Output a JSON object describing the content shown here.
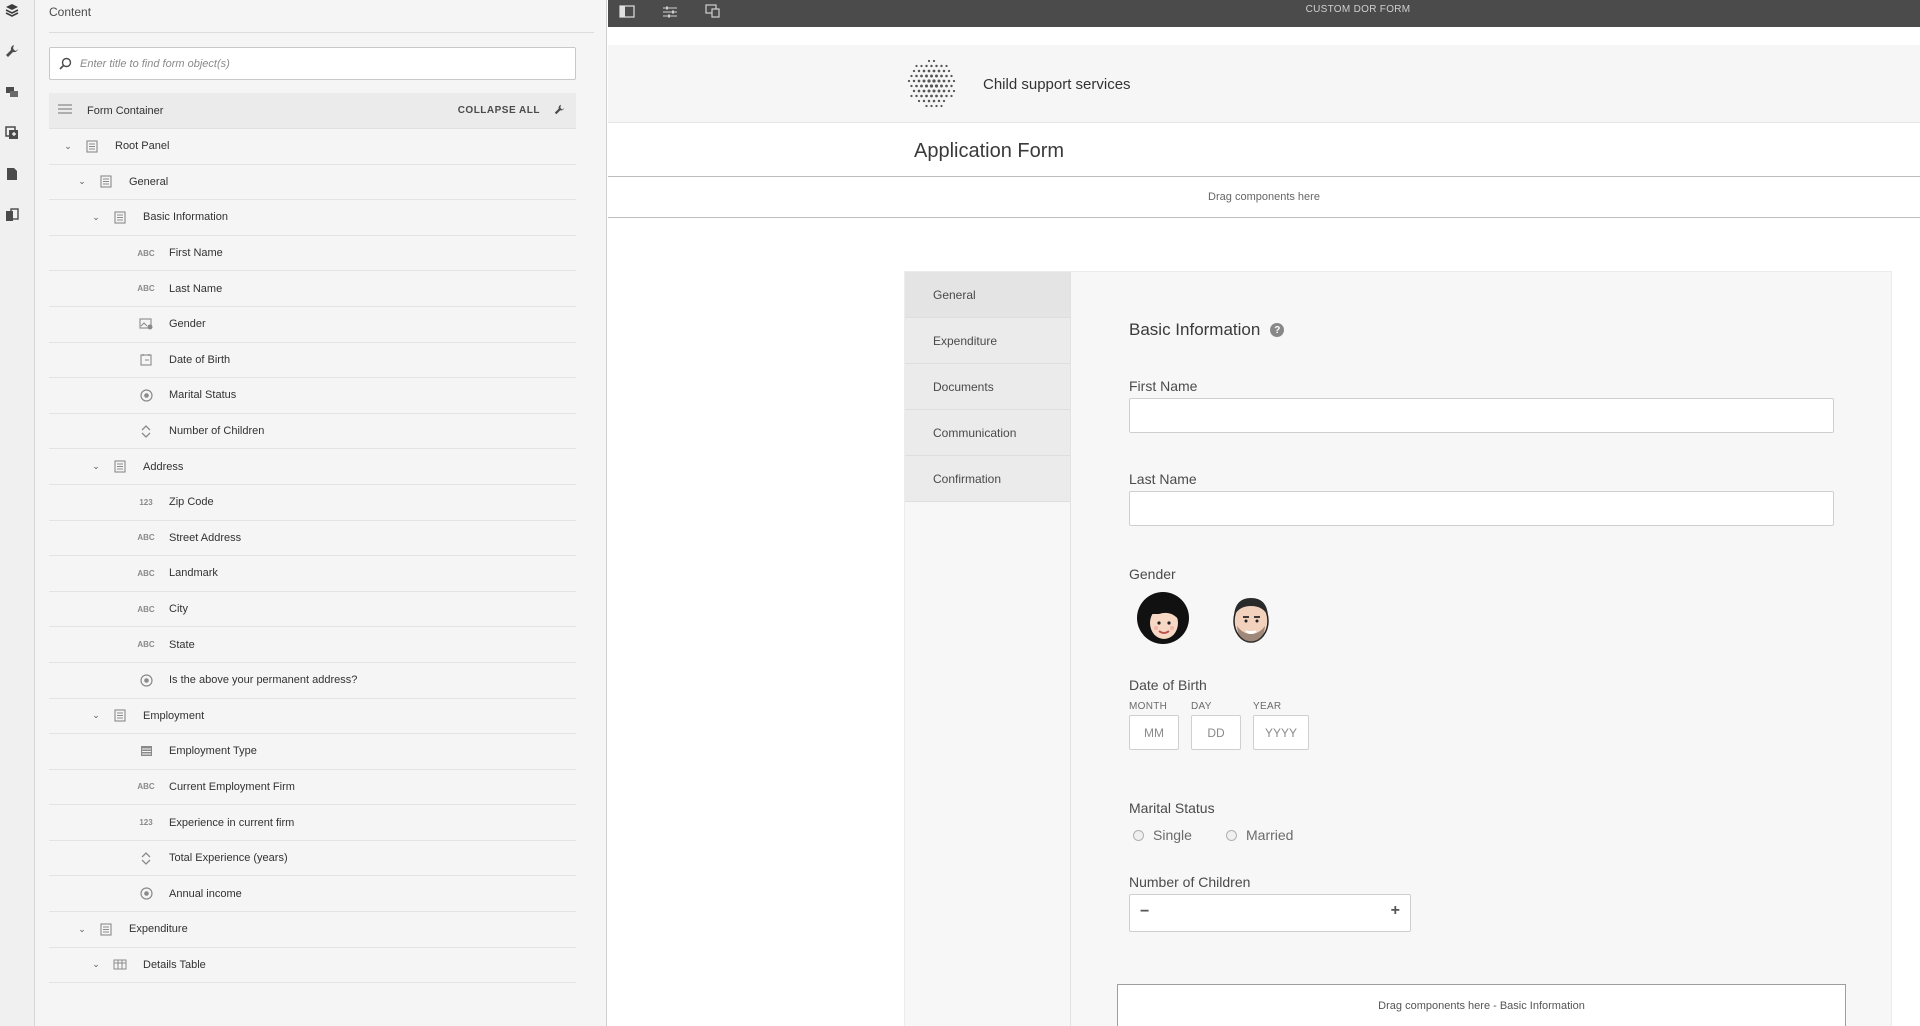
{
  "panel": {
    "title": "Content",
    "search_placeholder": "Enter title to find form object(s)",
    "collapse_all": "COLLAPSE ALL",
    "container_label": "Form Container"
  },
  "tree": [
    {
      "label": "Root Panel",
      "icon": "panel-icon",
      "level": 0,
      "chevron": true
    },
    {
      "label": "General",
      "icon": "panel-icon",
      "level": 1,
      "chevron": true
    },
    {
      "label": "Basic Information",
      "icon": "panel-icon",
      "level": 2,
      "chevron": true
    },
    {
      "label": "First Name",
      "icon": "text-field-icon",
      "level": 3,
      "chevron": false
    },
    {
      "label": "Last Name",
      "icon": "text-field-icon",
      "level": 3,
      "chevron": false
    },
    {
      "label": "Gender",
      "icon": "image-choice-icon",
      "level": 3,
      "chevron": false
    },
    {
      "label": "Date of Birth",
      "icon": "date-icon",
      "level": 3,
      "chevron": false
    },
    {
      "label": "Marital Status",
      "icon": "radio-icon",
      "level": 3,
      "chevron": false
    },
    {
      "label": "Number of Children",
      "icon": "stepper-icon",
      "level": 3,
      "chevron": false
    },
    {
      "label": "Address",
      "icon": "panel-icon",
      "level": 2,
      "chevron": true
    },
    {
      "label": "Zip Code",
      "icon": "numeric-field-icon",
      "level": 3,
      "chevron": false
    },
    {
      "label": "Street Address",
      "icon": "text-field-icon",
      "level": 3,
      "chevron": false
    },
    {
      "label": "Landmark",
      "icon": "text-field-icon",
      "level": 3,
      "chevron": false
    },
    {
      "label": "City",
      "icon": "text-field-icon",
      "level": 3,
      "chevron": false
    },
    {
      "label": "State",
      "icon": "text-field-icon",
      "level": 3,
      "chevron": false
    },
    {
      "label": "Is the above your permanent address?",
      "icon": "radio-icon",
      "level": 3,
      "chevron": false
    },
    {
      "label": "Employment",
      "icon": "panel-icon",
      "level": 2,
      "chevron": true
    },
    {
      "label": "Employment Type",
      "icon": "dropdown-icon",
      "level": 3,
      "chevron": false
    },
    {
      "label": "Current Employment Firm",
      "icon": "text-field-icon",
      "level": 3,
      "chevron": false
    },
    {
      "label": "Experience in current firm",
      "icon": "numeric-field-icon",
      "level": 3,
      "chevron": false
    },
    {
      "label": "Total Experience (years)",
      "icon": "stepper-icon",
      "level": 3,
      "chevron": false
    },
    {
      "label": "Annual income",
      "icon": "radio-icon",
      "level": 3,
      "chevron": false
    },
    {
      "label": "Expenditure",
      "icon": "panel-icon",
      "level": 1,
      "chevron": true
    },
    {
      "label": "Details Table",
      "icon": "table-icon",
      "level": 2,
      "chevron": true
    }
  ],
  "icon_text": {
    "text": "ABC",
    "numeric": "123"
  },
  "topbar": {
    "title": "CUSTOM DOR FORM"
  },
  "form": {
    "brand_name": "Child support services",
    "title": "Application Form",
    "drop_top": "Drag components here",
    "tabs": [
      "General",
      "Expenditure",
      "Documents",
      "Communication",
      "Confirmation"
    ],
    "section_title": "Basic Information",
    "help": "?",
    "first_name_label": "First Name",
    "last_name_label": "Last Name",
    "gender_label": "Gender",
    "dob_label": "Date of Birth",
    "dob_month_label": "MONTH",
    "dob_day_label": "DAY",
    "dob_year_label": "YEAR",
    "dob_month_placeholder": "MM",
    "dob_day_placeholder": "DD",
    "dob_year_placeholder": "YYYY",
    "marital_label": "Marital Status",
    "marital_options": [
      "Single",
      "Married"
    ],
    "children_label": "Number of Children",
    "drop_inner": "Drag components here - Basic Information"
  },
  "colors": {
    "topbar": "#4b4b4b",
    "panel_bg": "#f5f5f5",
    "tab_bg": "#ebebeb"
  }
}
